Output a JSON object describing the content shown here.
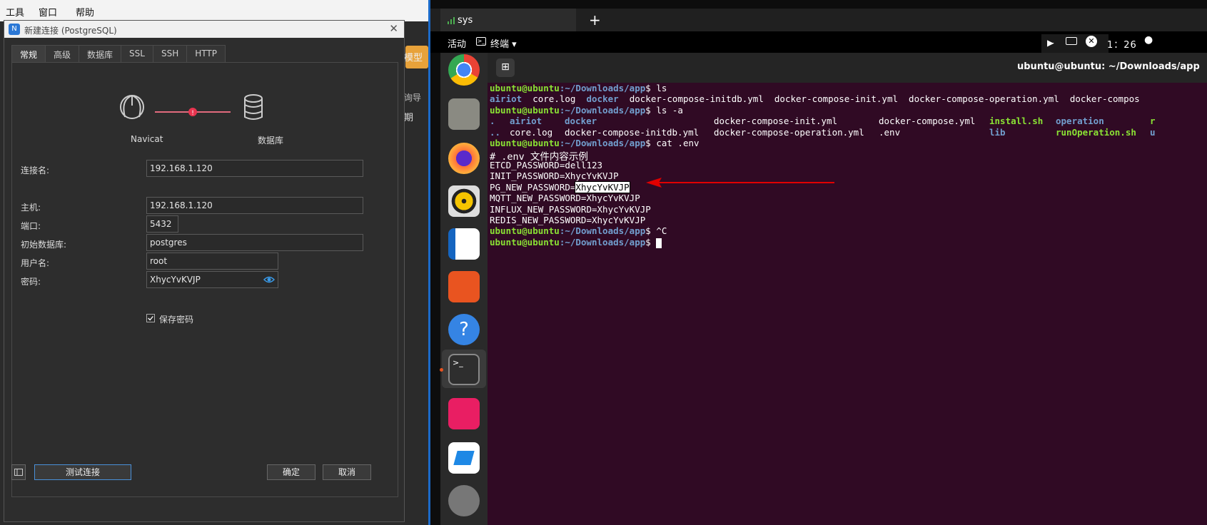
{
  "host": {
    "menu": [
      "工具",
      "窗口",
      "帮助"
    ],
    "model_label": "模型",
    "side_labels": [
      "询导",
      "期"
    ]
  },
  "dialog": {
    "title": "新建连接 (PostgreSQL)",
    "tabs": [
      "常规",
      "高级",
      "数据库",
      "SSL",
      "SSH",
      "HTTP"
    ],
    "graphic": {
      "left_label": "Navicat",
      "right_label": "数据库"
    },
    "fields": {
      "conn_name": {
        "label": "连接名:",
        "value": "192.168.1.120"
      },
      "host": {
        "label": "主机:",
        "value": "192.168.1.120"
      },
      "port": {
        "label": "端口:",
        "value": "5432"
      },
      "init_db": {
        "label": "初始数据库:",
        "value": "postgres"
      },
      "user": {
        "label": "用户名:",
        "value": "root"
      },
      "password": {
        "label": "密码:",
        "value": "XhycYvKVJP"
      }
    },
    "save_password": {
      "label": "保存密码",
      "checked": true
    },
    "buttons": {
      "test": "测试连接",
      "ok": "确定",
      "cancel": "取消"
    }
  },
  "ubuntu": {
    "tab_name": "sys",
    "activities": "活动",
    "terminal_menu": "终端 ▾",
    "clock": "1：26",
    "window_title": "ubuntu@ubuntu: ~/Downloads/app",
    "prompt_user": "ubuntu@ubuntu",
    "prompt_path": ":~/Downloads/app",
    "colors": {
      "accent": "#1b6ac9",
      "terminal_bg": "#300a24",
      "arrow": "#e00000"
    },
    "dock_icons": [
      "chrome-icon",
      "files-icon",
      "firefox-icon",
      "rhythmbox-icon",
      "libreoffice-writer-icon",
      "app-center-icon",
      "help-icon",
      "terminal-icon",
      "pink-app-icon",
      "blue-app-icon",
      "settings-icon"
    ],
    "terminal": {
      "cmd1": "$ ls",
      "ls_out": [
        "airiot",
        "core.log",
        "docker",
        "docker-compose-initdb.yml  docker-compose-init.yml  docker-compose-operation.yml  docker-compos"
      ],
      "cmd2": "$ ls -a",
      "lsa_row1": [
        ".",
        "airiot",
        "docker",
        "docker-compose-init.yml",
        "docker-compose.yml",
        "install.sh",
        "operation",
        "r"
      ],
      "lsa_row2": [
        "..",
        "core.log",
        "docker-compose-initdb.yml",
        "docker-compose-operation.yml",
        ".env",
        "lib",
        "runOperation.sh",
        "u"
      ],
      "cmd3": "$ cat .env",
      "env_lines": [
        "# .env 文件内容示例",
        "ETCD_PASSWORD=dell123",
        "INIT_PASSWORD=XhycYvKVJP",
        "MQTT_NEW_PASSWORD=XhycYvKVJP",
        "INFLUX_NEW_PASSWORD=XhycYvKVJP",
        "REDIS_NEW_PASSWORD=XhycYvKVJP"
      ],
      "pg_key": "PG_NEW_PASSWORD=",
      "pg_value": "XhycYvKVJP",
      "cmd4": "$ ^C",
      "cmd5": "$ "
    }
  }
}
